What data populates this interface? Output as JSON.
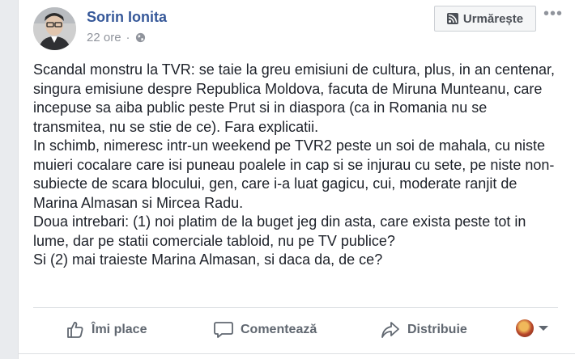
{
  "post": {
    "author": "Sorin Ionita",
    "time": "22 ore",
    "separator": "·",
    "follow_label": "Urmărește",
    "more_label": "•••",
    "paragraphs": [
      "Scandal monstru la TVR: se taie la greu emisiuni de cultura, plus, in an centenar, singura emisiune despre Republica Moldova, facuta de Miruna Munteanu, care incepuse sa aiba public peste Prut si in diaspora (ca in Romania nu se transmitea, nu se stie de ce). Fara explicatii.",
      "In schimb, nimeresc intr-un weekend pe TVR2 peste un soi de mahala, cu niste muieri cocalare care isi puneau poalele in cap si se injurau cu sete, pe niste non-subiecte de scara blocului, gen, care i-a luat gagicu, cui, moderate ranjit de Marina Almasan si Mircea Radu.",
      "Doua intrebari: (1) noi platim de la buget jeg din asta, care exista peste tot in lume, dar pe statii comerciale tabloid, nu pe TV publice?",
      "Si (2) mai traieste Marina Almasan, si daca da, de ce?"
    ]
  },
  "actions": {
    "like_label": "Îmi place",
    "comment_label": "Comentează",
    "share_label": "Distribuie"
  },
  "icons": {
    "like": "thumbs-up-icon",
    "comment": "speech-bubble-icon",
    "share": "share-arrow-icon",
    "privacy": "globe-icon",
    "follow": "rss-icon",
    "more": "ellipsis-icon"
  },
  "colors": {
    "author": "#365899",
    "text": "#1d2129",
    "secondary": "#90949c",
    "action": "#606770"
  }
}
